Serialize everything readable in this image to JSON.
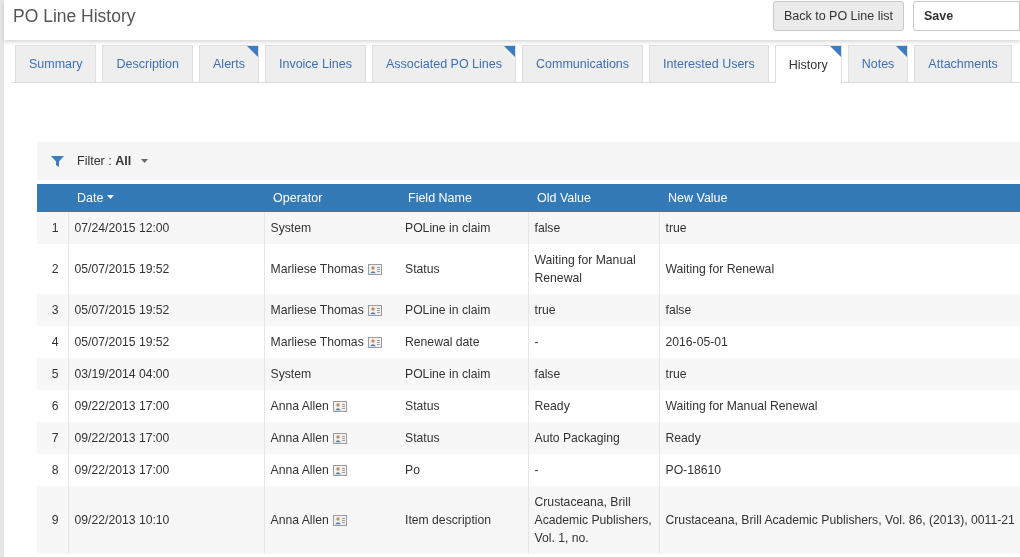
{
  "header": {
    "title": "PO Line History",
    "buttons": [
      {
        "label": "Back to PO Line list",
        "kind": "default"
      },
      {
        "label": "Save",
        "kind": "primary"
      }
    ]
  },
  "tabs": [
    {
      "label": "Summary",
      "selected": false,
      "flagged": false
    },
    {
      "label": "Description",
      "selected": false,
      "flagged": false
    },
    {
      "label": "Alerts",
      "selected": false,
      "flagged": true
    },
    {
      "label": "Invoice Lines",
      "selected": false,
      "flagged": false
    },
    {
      "label": "Associated PO Lines",
      "selected": false,
      "flagged": true
    },
    {
      "label": "Communications",
      "selected": false,
      "flagged": false
    },
    {
      "label": "Interested Users",
      "selected": false,
      "flagged": false
    },
    {
      "label": "History",
      "selected": true,
      "flagged": true
    },
    {
      "label": "Notes",
      "selected": false,
      "flagged": true
    },
    {
      "label": "Attachments",
      "selected": false,
      "flagged": false
    }
  ],
  "filter": {
    "text": "Filter : **All**"
  },
  "table": {
    "columns": [
      {
        "label": "Date",
        "sorted": true
      },
      {
        "label": "Operator",
        "sorted": false
      },
      {
        "label": "Field Name",
        "sorted": false
      },
      {
        "label": "Old Value",
        "sorted": false
      },
      {
        "label": "New Value",
        "sorted": false
      }
    ],
    "rows": [
      {
        "number": "1",
        "date": "07/24/2015 12:00",
        "operator": {
          "name": "System",
          "user_card": false
        },
        "field_name": "POLine in claim",
        "old_value": "false",
        "new_value": "true"
      },
      {
        "number": "2",
        "date": "05/07/2015 19:52",
        "operator": {
          "name": "Marliese Thomas",
          "user_card": true
        },
        "field_name": "Status",
        "old_value": "Waiting for Manual Renewal",
        "new_value": "Waiting for Renewal"
      },
      {
        "number": "3",
        "date": "05/07/2015 19:52",
        "operator": {
          "name": "Marliese Thomas",
          "user_card": true
        },
        "field_name": "POLine in claim",
        "old_value": "true",
        "new_value": "false"
      },
      {
        "number": "4",
        "date": "05/07/2015 19:52",
        "operator": {
          "name": "Marliese Thomas",
          "user_card": true
        },
        "field_name": "Renewal date",
        "old_value": "-",
        "new_value": "2016-05-01"
      },
      {
        "number": "5",
        "date": "03/19/2014 04:00",
        "operator": {
          "name": "System",
          "user_card": false
        },
        "field_name": "POLine in claim",
        "old_value": "false",
        "new_value": "true"
      },
      {
        "number": "6",
        "date": "09/22/2013 17:00",
        "operator": {
          "name": "Anna Allen",
          "user_card": true
        },
        "field_name": "Status",
        "old_value": "Ready",
        "new_value": "Waiting for Manual Renewal"
      },
      {
        "number": "7",
        "date": "09/22/2013 17:00",
        "operator": {
          "name": "Anna Allen",
          "user_card": true
        },
        "field_name": "Status",
        "old_value": "Auto Packaging",
        "new_value": "Ready"
      },
      {
        "number": "8",
        "date": "09/22/2013 17:00",
        "operator": {
          "name": "Anna Allen",
          "user_card": true
        },
        "field_name": "Po",
        "old_value": "-",
        "new_value": "PO-18610"
      },
      {
        "number": "9",
        "date": "09/22/2013 10:10",
        "operator": {
          "name": "Anna Allen",
          "user_card": true
        },
        "field_name": "Item description",
        "old_value": "Crustaceana, Brill Academic Publishers, Vol. 1, no.",
        "new_value": "Crustaceana, Brill Academic Publishers, Vol. 86, (2013), 0011-21"
      }
    ]
  }
}
